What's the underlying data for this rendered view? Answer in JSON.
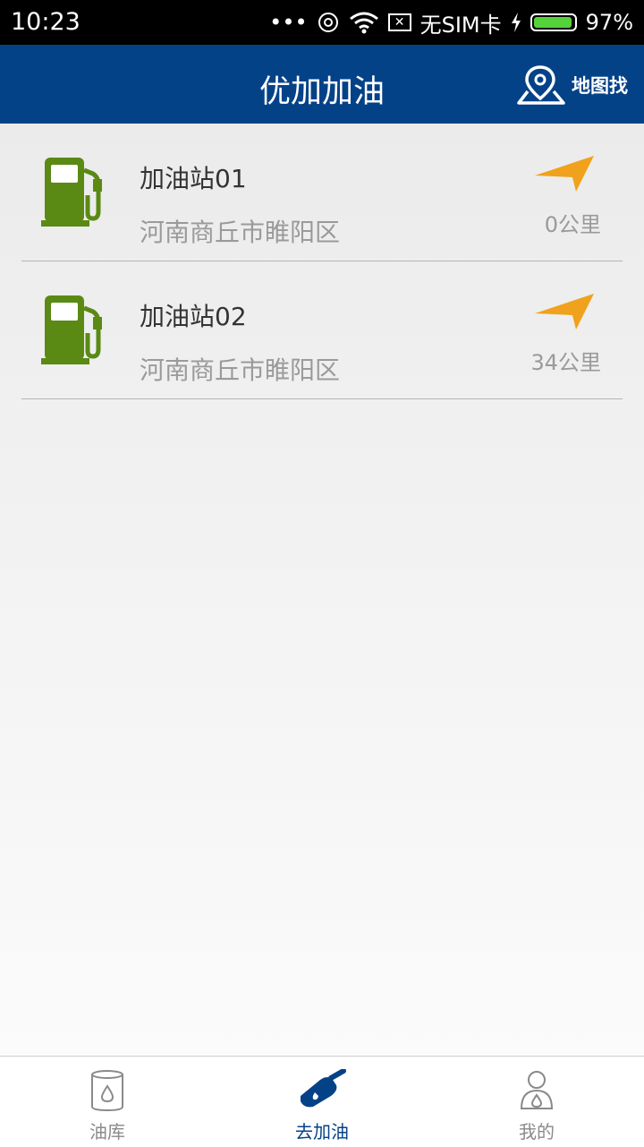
{
  "status_bar": {
    "time": "10:23",
    "dots": "•••",
    "sim_text": "无SIM卡",
    "battery_percent": "97%",
    "battery_level": 0.97
  },
  "header": {
    "title": "优加加油",
    "map_label": "地图找"
  },
  "stations": [
    {
      "name": "加油站01",
      "address": "河南商丘市睢阳区",
      "distance": "0公里"
    },
    {
      "name": "加油站02",
      "address": "河南商丘市睢阳区",
      "distance": "34公里"
    }
  ],
  "bottom_nav": {
    "tabs": [
      {
        "label": "油库",
        "icon": "oil-tank-icon"
      },
      {
        "label": "去加油",
        "icon": "fuel-nozzle-icon"
      },
      {
        "label": "我的",
        "icon": "user-profile-icon"
      }
    ],
    "active_index": 1
  },
  "colors": {
    "header": "#044288",
    "pump": "#5a8a14",
    "arrow": "#f0a21c",
    "battery": "#55d23a"
  }
}
